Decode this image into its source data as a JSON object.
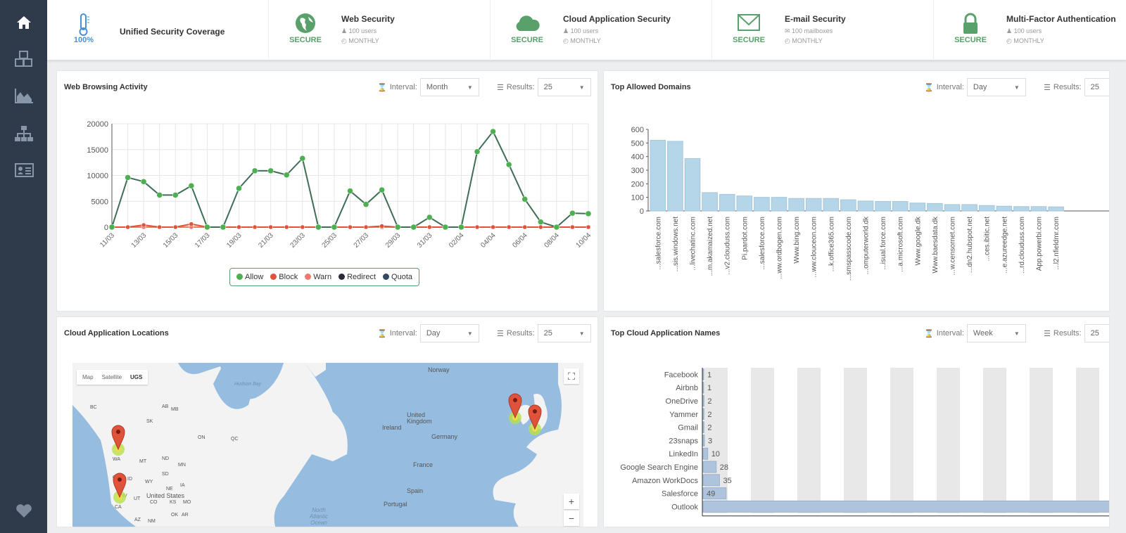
{
  "sidebar": {
    "items": [
      {
        "icon": "home-icon"
      },
      {
        "icon": "cubes-icon"
      },
      {
        "icon": "area-chart-icon"
      },
      {
        "icon": "sitemap-icon"
      },
      {
        "icon": "id-card-icon"
      },
      {
        "icon": "heart-icon"
      }
    ]
  },
  "topbar": {
    "cells": [
      {
        "icon": "thermometer-icon",
        "status": "100%",
        "title": "Unified Security Coverage"
      },
      {
        "icon": "globe-icon",
        "status": "SECURE",
        "title": "Web Security",
        "line1": "100 users",
        "line2": "MONTHLY"
      },
      {
        "icon": "cloud-icon",
        "status": "SECURE",
        "title": "Cloud Application Security",
        "line1": "100 users",
        "line2": "MONTHLY"
      },
      {
        "icon": "envelope-icon",
        "status": "SECURE",
        "title": "E-mail Security",
        "line1": "100 mailboxes",
        "line2": "MONTHLY"
      },
      {
        "icon": "lock-icon",
        "status": "SECURE",
        "title": "Multi-Factor Authentication",
        "line1": "100 users",
        "line2": "MONTHLY"
      }
    ]
  },
  "colors": {
    "accent": "#5aa06a",
    "sidebar": "#2f3b4b",
    "allow": "#4caf50",
    "block": "#e0533b",
    "bar": "#b5d6e8",
    "cloud_bar": "#aec4dc"
  },
  "labels": {
    "interval": "Interval:",
    "results": "Results:"
  },
  "panels": {
    "web": {
      "title": "Web Browsing Activity",
      "interval": "Month",
      "results": "25"
    },
    "domains": {
      "title": "Top Allowed Domains",
      "interval": "Day",
      "results": "25"
    },
    "locations": {
      "title": "Cloud Application Locations",
      "interval": "Day",
      "results": "25"
    },
    "apps": {
      "title": "Top Cloud Application Names",
      "interval": "Week",
      "results": "25"
    }
  },
  "map": {
    "types": [
      "Map",
      "Satellite",
      "UGS"
    ],
    "labels": [
      "Hudson Bay",
      "BC",
      "AB",
      "SK",
      "MB",
      "ON",
      "QC",
      "WA",
      "MT",
      "ND",
      "MN",
      "OR",
      "ID",
      "WY",
      "SD",
      "NV",
      "UT",
      "CO",
      "NE",
      "IA",
      "KS",
      "MO",
      "CA",
      "AZ",
      "NM",
      "OK",
      "AR",
      "United States",
      "North Atlantic Ocean",
      "Ireland",
      "United Kingdom",
      "France",
      "Spain",
      "Portugal",
      "Germany",
      "Norway"
    ],
    "zoom_in": "+",
    "zoom_out": "−"
  },
  "chart_data": [
    {
      "type": "line",
      "title": "Web Browsing Activity",
      "ylim": [
        0,
        20000
      ],
      "yticks": [
        0,
        5000,
        10000,
        15000,
        20000
      ],
      "x": [
        "11/03",
        "12/03",
        "13/03",
        "14/03",
        "15/03",
        "16/03",
        "17/03",
        "18/03",
        "19/03",
        "20/03",
        "21/03",
        "22/03",
        "23/03",
        "24/03",
        "25/03",
        "26/03",
        "27/03",
        "28/03",
        "29/03",
        "30/03",
        "31/03",
        "01/04",
        "02/04",
        "03/04",
        "04/04",
        "05/04",
        "06/04",
        "07/04",
        "08/04",
        "09/04",
        "10/04"
      ],
      "xtick_labels": [
        "11/03",
        "13/03",
        "15/03",
        "17/03",
        "19/03",
        "21/03",
        "23/03",
        "25/03",
        "27/03",
        "29/03",
        "31/03",
        "02/04",
        "04/04",
        "06/04",
        "08/04",
        "10/04"
      ],
      "series": [
        {
          "name": "Allow",
          "color": "#4caf50",
          "values": [
            0,
            9600,
            8800,
            6200,
            6200,
            8000,
            0,
            0,
            7500,
            10900,
            10900,
            10100,
            13300,
            0,
            0,
            7000,
            4400,
            7200,
            0,
            0,
            1900,
            0,
            0,
            14600,
            18500,
            12100,
            5400,
            1000,
            0,
            2700,
            2600
          ]
        },
        {
          "name": "Block",
          "color": "#e0533b",
          "values": [
            0,
            0,
            400,
            0,
            0,
            600,
            0,
            0,
            0,
            0,
            0,
            0,
            0,
            0,
            0,
            0,
            0,
            200,
            0,
            0,
            0,
            0,
            0,
            0,
            0,
            0,
            0,
            0,
            0,
            0,
            0
          ]
        },
        {
          "name": "Warn",
          "color": "#f07a6a",
          "values": [
            0,
            0,
            0,
            0,
            0,
            0,
            0,
            0,
            0,
            0,
            0,
            0,
            0,
            0,
            0,
            0,
            0,
            0,
            0,
            0,
            0,
            0,
            0,
            0,
            0,
            0,
            0,
            0,
            0,
            0,
            0
          ]
        },
        {
          "name": "Redirect",
          "color": "#2a2a3a",
          "values": [
            0,
            0,
            0,
            0,
            0,
            0,
            0,
            0,
            0,
            0,
            0,
            0,
            0,
            0,
            0,
            0,
            0,
            0,
            0,
            0,
            0,
            0,
            0,
            0,
            0,
            0,
            0,
            0,
            0,
            0,
            0
          ]
        },
        {
          "name": "Quota",
          "color": "#34495e",
          "values": [
            0,
            0,
            0,
            0,
            0,
            0,
            0,
            0,
            0,
            0,
            0,
            0,
            0,
            0,
            0,
            0,
            0,
            0,
            0,
            0,
            0,
            0,
            0,
            0,
            0,
            0,
            0,
            0,
            0,
            0,
            0
          ]
        }
      ],
      "legend": "bottom",
      "grid": true
    },
    {
      "type": "bar",
      "title": "Top Allowed Domains",
      "ylim": [
        0,
        600
      ],
      "yticks": [
        0,
        100,
        200,
        300,
        400,
        500,
        600
      ],
      "categories": [
        "...salesforce.com",
        "...sis.windows.net",
        "...livechatinc.com",
        "...m.akamaized.net",
        "...v2.clouduss.com",
        "Pi.pardot.com",
        "...salesforce.com",
        "...ww.ordbogen.com",
        "Www.bing.com",
        "...ww.clouceon.com",
        "...k.office365.com",
        "...smspasscode.com",
        "...omputerworld.dk",
        "...isual.force.com",
        "...a.microsoft.com",
        "Www.google.dk",
        "Www.baesdata.dk",
        "...w.censornet.com",
        "...dn2.hubspot.net",
        "...ces.ibitic.net",
        "...e.azureedge.net",
        "...rd.clouduss.com",
        "App.powerbi.com",
        "...l2.nfieldmr.com"
      ],
      "values": [
        520,
        512,
        385,
        135,
        122,
        110,
        100,
        100,
        92,
        92,
        92,
        82,
        73,
        70,
        70,
        58,
        55,
        47,
        47,
        40,
        35,
        32,
        32,
        30
      ]
    },
    {
      "type": "bar",
      "orientation": "horizontal",
      "title": "Top Cloud Application Names",
      "categories": [
        "Facebook",
        "Airbnb",
        "OneDrive",
        "Yammer",
        "Gmail",
        "23snaps",
        "LinkedIn",
        "Google Search Engine",
        "Amazon WorkDocs",
        "Salesforce",
        "Outlook"
      ],
      "values": [
        1,
        1,
        2,
        2,
        2,
        3,
        10,
        28,
        35,
        49,
        900
      ],
      "data_labels": [
        "1",
        "1",
        "2",
        "2",
        "2",
        "3",
        "10",
        "28",
        "35",
        "49",
        ""
      ]
    }
  ]
}
